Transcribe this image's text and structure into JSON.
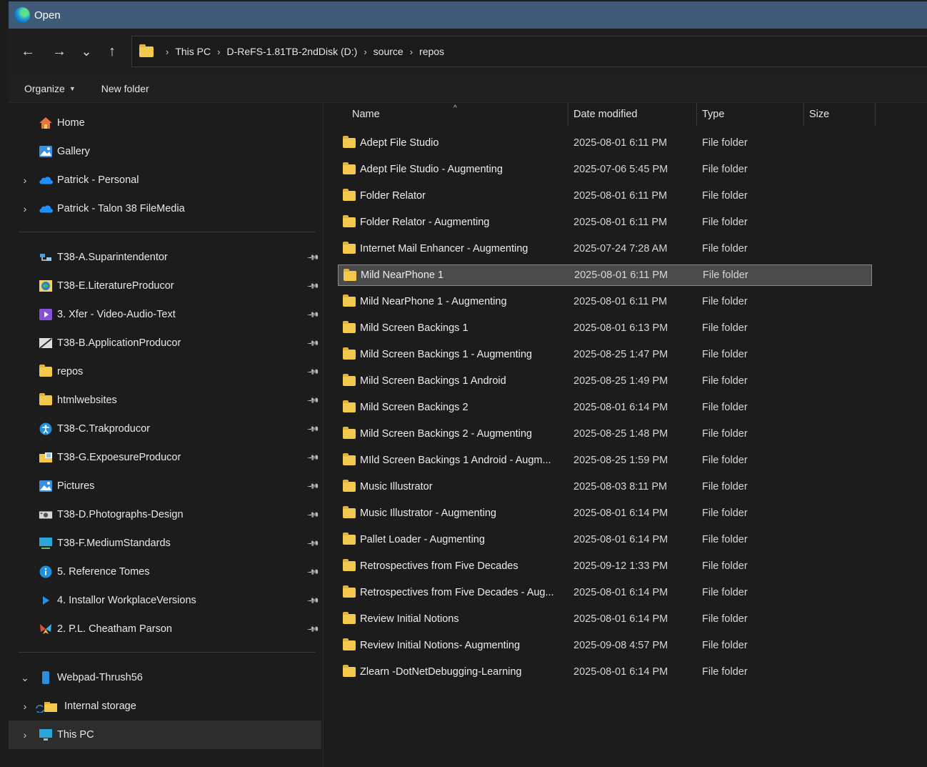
{
  "window": {
    "title": "Open"
  },
  "nav": {
    "back": "←",
    "forward": "→",
    "recent": "⌄",
    "up": "↑"
  },
  "breadcrumbs": [
    "This PC",
    "D-ReFS-1.81TB-2ndDisk (D:)",
    "source",
    "repos"
  ],
  "breadcrumb_sep": "›",
  "toolbar": {
    "organize_label": "Organize",
    "organize_caret": "▼",
    "new_folder_label": "New folder"
  },
  "sidebar": {
    "top_items": [
      {
        "label": "Home",
        "icon": "home-icon",
        "expander": ""
      },
      {
        "label": "Gallery",
        "icon": "gallery-icon",
        "expander": ""
      },
      {
        "label": "Patrick - Personal",
        "icon": "onedrive-icon",
        "expander": "›"
      },
      {
        "label": "Patrick - Talon 38 FileMedia",
        "icon": "onedrive-icon",
        "expander": "›"
      }
    ],
    "pinned_items": [
      {
        "label": "T38-A.Suparintendentor",
        "icon": "network-icon"
      },
      {
        "label": "T38-E.LiteratureProducor",
        "icon": "globe-icon"
      },
      {
        "label": "3. Xfer - Video-Audio-Text",
        "icon": "video-icon"
      },
      {
        "label": "T38-B.ApplicationProducor",
        "icon": "app-icon"
      },
      {
        "label": "repos",
        "icon": "folder-icon"
      },
      {
        "label": "htmlwebsites",
        "icon": "folder-icon"
      },
      {
        "label": "T38-C.Trakproducor",
        "icon": "accessibility-icon"
      },
      {
        "label": "T38-G.ExpoesureProducor",
        "icon": "folder-grid-icon"
      },
      {
        "label": "Pictures",
        "icon": "pictures-icon"
      },
      {
        "label": "T38-D.Photographs-Design",
        "icon": "camera-icon"
      },
      {
        "label": "T38-F.MediumStandards",
        "icon": "monitor-icon"
      },
      {
        "label": "5. Reference Tomes",
        "icon": "info-icon"
      },
      {
        "label": "4. Installor WorkplaceVersions",
        "icon": "play-icon"
      },
      {
        "label": "2. P.L. Cheatham Parson",
        "icon": "butterfly-icon"
      }
    ],
    "pin_glyph": "📌",
    "device_items": [
      {
        "label": "Webpad-Thrush56",
        "icon": "phone-icon",
        "expander": "⌄"
      },
      {
        "label": "Internal storage",
        "icon": "folder-sync-icon",
        "expander": "›"
      },
      {
        "label": "This PC",
        "icon": "pc-icon",
        "expander": "›"
      }
    ]
  },
  "columns": {
    "name": "Name",
    "date": "Date modified",
    "type": "Type",
    "size": "Size",
    "sort_glyph": "^"
  },
  "files": [
    {
      "name": "Adept File Studio",
      "date": "2025-08-01 6:11 PM",
      "type": "File folder"
    },
    {
      "name": "Adept File Studio - Augmenting",
      "date": "2025-07-06 5:45 PM",
      "type": "File folder"
    },
    {
      "name": "Folder Relator",
      "date": "2025-08-01 6:11 PM",
      "type": "File folder"
    },
    {
      "name": "Folder Relator - Augmenting",
      "date": "2025-08-01 6:11 PM",
      "type": "File folder"
    },
    {
      "name": "Internet Mail Enhancer - Augmenting",
      "date": "2025-07-24 7:28 AM",
      "type": "File folder"
    },
    {
      "name": "Mild NearPhone 1",
      "date": "2025-08-01 6:11 PM",
      "type": "File folder",
      "selected": true
    },
    {
      "name": "Mild NearPhone 1 - Augmenting",
      "date": "2025-08-01 6:11 PM",
      "type": "File folder"
    },
    {
      "name": "Mild Screen Backings 1",
      "date": "2025-08-01 6:13 PM",
      "type": "File folder"
    },
    {
      "name": "Mild Screen Backings 1 - Augmenting",
      "date": "2025-08-25 1:47 PM",
      "type": "File folder"
    },
    {
      "name": "Mild Screen Backings 1 Android",
      "date": "2025-08-25 1:49 PM",
      "type": "File folder"
    },
    {
      "name": "Mild Screen Backings 2",
      "date": "2025-08-01 6:14 PM",
      "type": "File folder"
    },
    {
      "name": "Mild Screen Backings 2 - Augmenting",
      "date": "2025-08-25 1:48 PM",
      "type": "File folder"
    },
    {
      "name": "MIld Screen Backings 1 Android -  Augm...",
      "date": "2025-08-25 1:59 PM",
      "type": "File folder"
    },
    {
      "name": "Music Illustrator",
      "date": "2025-08-03 8:11 PM",
      "type": "File folder"
    },
    {
      "name": "Music Illustrator - Augmenting",
      "date": "2025-08-01 6:14 PM",
      "type": "File folder"
    },
    {
      "name": "Pallet Loader - Augmenting",
      "date": "2025-08-01 6:14 PM",
      "type": "File folder"
    },
    {
      "name": "Retrospectives from Five Decades",
      "date": "2025-09-12 1:33 PM",
      "type": "File folder"
    },
    {
      "name": "Retrospectives from Five Decades - Aug...",
      "date": "2025-08-01 6:14 PM",
      "type": "File folder"
    },
    {
      "name": "Review Initial Notions",
      "date": "2025-08-01 6:14 PM",
      "type": "File folder"
    },
    {
      "name": "Review Initial Notions- Augmenting",
      "date": "2025-09-08 4:57 PM",
      "type": "File folder"
    },
    {
      "name": "Zlearn -DotNetDebugging-Learning",
      "date": "2025-08-01 6:14 PM",
      "type": "File folder"
    }
  ],
  "colors": {
    "titlebar": "#3f5b78",
    "folder": "#f2c94c",
    "background": "#1c1c1c",
    "selection": "#4b4b4b"
  }
}
